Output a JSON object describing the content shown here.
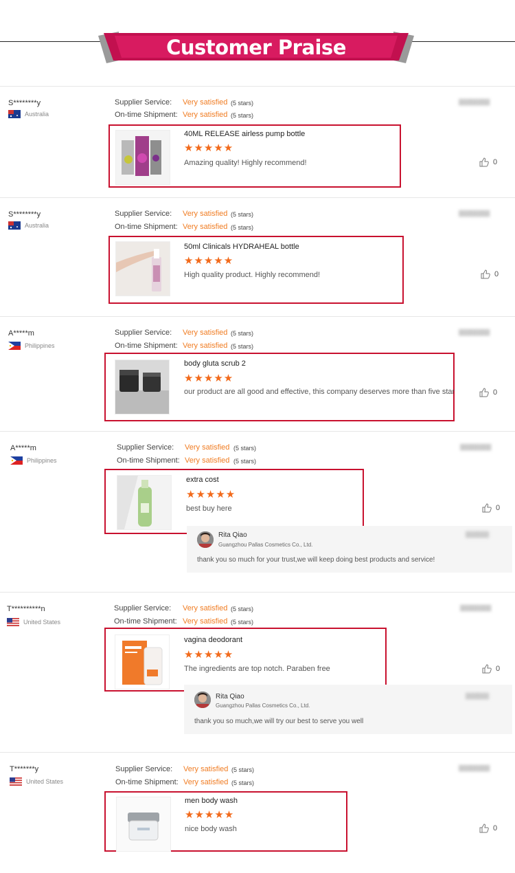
{
  "banner": {
    "title": "Customer Praise"
  },
  "labels": {
    "supplier_service": "Supplier Service:",
    "ontime_shipment": "On-time Shipment:",
    "very_satisfied": "Very satisfied",
    "five_stars_text": "(5 stars)",
    "stars_glyph": "★★★★★"
  },
  "colors": {
    "accent": "#f07c22",
    "box_border": "#c8102e",
    "banner": "#c2104f"
  },
  "reviews": [
    {
      "user": "S********y",
      "country": "Australia",
      "flag": "australia-flag-icon",
      "product": "40ML RELEASE airless pump bottle",
      "comment": "Amazing quality! Highly recommend!",
      "likes": "0"
    },
    {
      "user": "S********y",
      "country": "Australia",
      "flag": "australia-flag-icon",
      "product": "50ml Clinicals HYDRAHEAL bottle",
      "comment": "High quality product. Highly recommend!",
      "likes": "0"
    },
    {
      "user": "A*****m",
      "country": "Philippines",
      "flag": "philippines-flag-icon",
      "product": "body gluta scrub 2",
      "comment": "our product are all good and effective, this company deserves more than five star",
      "likes": "0"
    },
    {
      "user": "A*****m",
      "country": "Philippines",
      "flag": "philippines-flag-icon",
      "product": "extra cost",
      "comment": "best buy here",
      "likes": "0",
      "reply": {
        "name": "Rita Qiao",
        "company": "Guangzhou Pallas Cosmetics Co., Ltd.",
        "text": "thank you so much for your trust,we will keep doing best products and service!"
      }
    },
    {
      "user": "T**********n",
      "country": "United States",
      "flag": "usa-flag-icon",
      "product": "vagina deodorant",
      "comment": "The ingredients are top notch. Paraben free",
      "likes": "0",
      "reply": {
        "name": "Rita Qiao",
        "company": "Guangzhou Pallas Cosmetics Co., Ltd.",
        "text": "thank you so much,we will try our best to serve you well"
      }
    },
    {
      "user": "T*******y",
      "country": "United States",
      "flag": "usa-flag-icon",
      "product": "men body wash",
      "comment": "nice body wash",
      "likes": "0"
    }
  ]
}
